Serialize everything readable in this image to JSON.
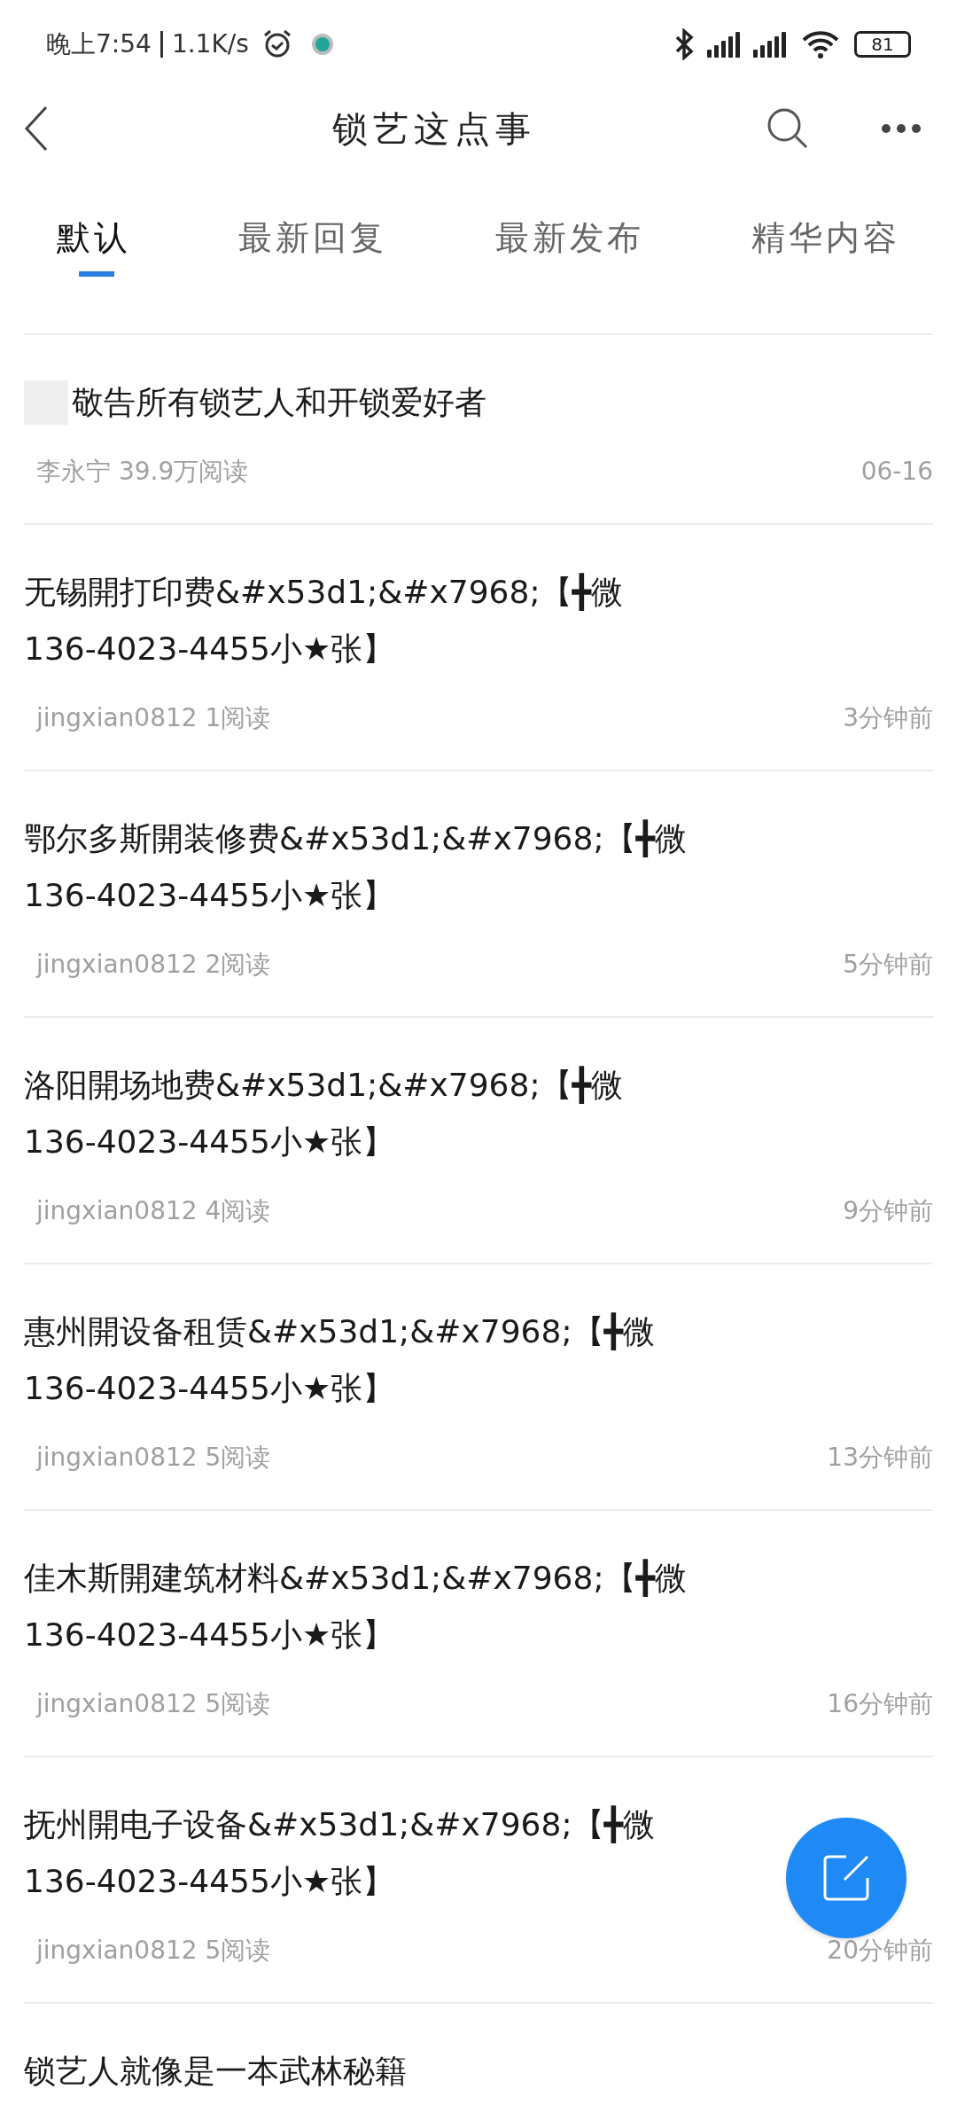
{
  "status_bar": {
    "time": "晚上7:54",
    "speed": "1.1K/s",
    "battery": "81"
  },
  "header": {
    "title": "锁艺这点事"
  },
  "tabs": [
    {
      "label": "默认",
      "selected": true
    },
    {
      "label": "最新回复",
      "selected": false
    },
    {
      "label": "最新发布",
      "selected": false
    },
    {
      "label": "精华内容",
      "selected": false
    }
  ],
  "posts": [
    {
      "title": "敬告所有锁艺人和开锁爱好者",
      "thumbnail": true,
      "meta": "李永宁 39.9万阅读",
      "time": "06-16"
    },
    {
      "title": "无锡開打印费&#x53d1;&#x7968;【╋微\n136-4023-4455小★张】",
      "thumbnail": false,
      "meta": "jingxian0812 1阅读",
      "time": "3分钟前"
    },
    {
      "title": "鄂尔多斯開装修费&#x53d1;&#x7968;【╋微\n136-4023-4455小★张】",
      "thumbnail": false,
      "meta": "jingxian0812 2阅读",
      "time": "5分钟前"
    },
    {
      "title": "洛阳開场地费&#x53d1;&#x7968;【╋微\n136-4023-4455小★张】",
      "thumbnail": false,
      "meta": "jingxian0812 4阅读",
      "time": "9分钟前"
    },
    {
      "title": "惠州開设备租赁&#x53d1;&#x7968;【╋微\n136-4023-4455小★张】",
      "thumbnail": false,
      "meta": "jingxian0812 5阅读",
      "time": "13分钟前"
    },
    {
      "title": "佳木斯開建筑材料&#x53d1;&#x7968;【╋微\n136-4023-4455小★张】",
      "thumbnail": false,
      "meta": "jingxian0812 5阅读",
      "time": "16分钟前"
    },
    {
      "title": "抚州開电子设备&#x53d1;&#x7968;【╋微\n136-4023-4455小★张】",
      "thumbnail": false,
      "meta": "jingxian0812 5阅读",
      "time": "20分钟前"
    },
    {
      "title": "锁艺人就像是一本武林秘籍",
      "thumbnail": false
    }
  ]
}
